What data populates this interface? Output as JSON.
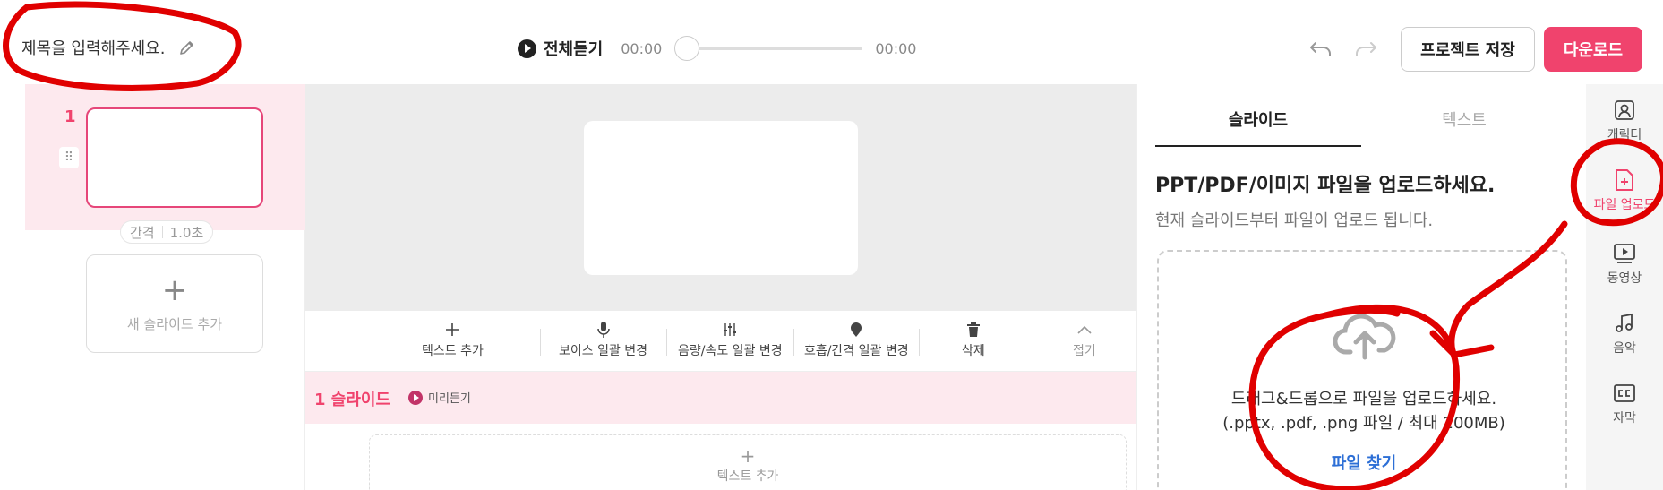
{
  "colors": {
    "accent": "#f0436d",
    "link": "#2d6fd6",
    "annotation": "#e00000"
  },
  "header": {
    "title_placeholder": "제목을 입력해주세요.",
    "play_all_label": "전체듣기",
    "time_current": "00:00",
    "time_total": "00:00",
    "save_label": "프로젝트 저장",
    "download_label": "다운로드"
  },
  "slides_panel": {
    "slide_number": "1",
    "gap_label": "간격",
    "gap_value": "1.0초",
    "add_slide_label": "새 슬라이드 추가"
  },
  "toolbar": {
    "items": [
      {
        "label": "텍스트 추가",
        "icon": "plus-icon"
      },
      {
        "label": "보이스 일괄 변경",
        "icon": "microphone-icon"
      },
      {
        "label": "음량/속도 일괄 변경",
        "icon": "sliders-icon"
      },
      {
        "label": "호흡/간격 일괄 변경",
        "icon": "breath-icon"
      },
      {
        "label": "삭제",
        "icon": "trash-icon"
      },
      {
        "label": "접기",
        "icon": "chevron-up-icon"
      }
    ]
  },
  "slide_section": {
    "title": "1 슬라이드",
    "preview_label": "미리듣기",
    "text_add_label": "텍스트 추가"
  },
  "right_panel": {
    "tabs": [
      "슬라이드",
      "텍스트"
    ],
    "heading": "PPT/PDF/이미지 파일을 업로드하세요.",
    "subheading": "현재 슬라이드부터 파일이 업로드 됩니다.",
    "drop_text": "드래그&드롭으로 파일을 업로드하세요.",
    "drop_hint": "(.pptx, .pdf, .png 파일 / 최대 200MB)",
    "find_file_label": "파일 찾기"
  },
  "side_nav": {
    "items": [
      {
        "label": "캐릭터",
        "icon": "character-icon"
      },
      {
        "label": "파일 업로드",
        "icon": "file-upload-icon",
        "active": true
      },
      {
        "label": "동영상",
        "icon": "video-icon"
      },
      {
        "label": "음악",
        "icon": "music-icon"
      },
      {
        "label": "자막",
        "icon": "subtitles-icon"
      }
    ]
  }
}
